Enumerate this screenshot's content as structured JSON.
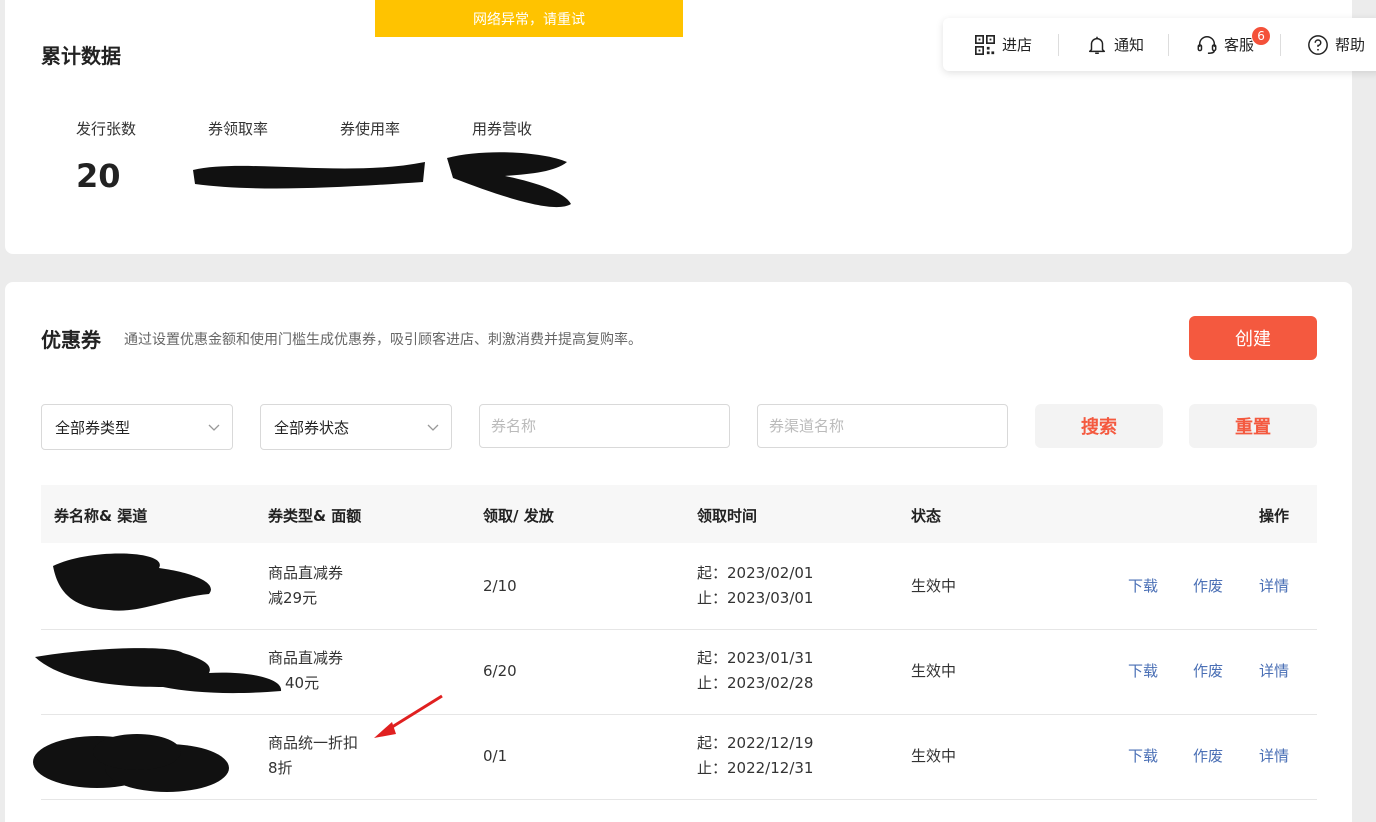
{
  "banner": {
    "text": "网络异常，请重试"
  },
  "topnav": {
    "items": [
      {
        "label": "进店",
        "icon": "qr-code-icon"
      },
      {
        "label": "通知",
        "icon": "bell-icon"
      },
      {
        "label": "客服",
        "icon": "headset-icon",
        "badge": "6"
      },
      {
        "label": "帮助",
        "icon": "help-circle-icon"
      }
    ]
  },
  "summary": {
    "title": "累计数据",
    "stats": [
      {
        "label": "发行张数",
        "value": "20"
      },
      {
        "label": "券领取率",
        "value": ""
      },
      {
        "label": "券使用率",
        "value": ""
      },
      {
        "label": "用券营收",
        "value": ""
      }
    ]
  },
  "coupons": {
    "title": "优惠券",
    "description": "通过设置优惠金额和使用门槛生成优惠券，吸引顾客进店、刺激消费并提高复购率。",
    "create_label": "创建",
    "filters": {
      "type_select": "全部券类型",
      "status_select": "全部券状态",
      "name_placeholder": "券名称",
      "channel_placeholder": "券渠道名称",
      "search_label": "搜索",
      "reset_label": "重置"
    },
    "columns": [
      "券名称& 渠道",
      "券类型& 面额",
      "领取/ 发放",
      "领取时间",
      "状态",
      "操作"
    ],
    "rows": [
      {
        "type": "商品直减券",
        "amount": "减29元",
        "ratio": "2/10",
        "start": "起：2023/02/01",
        "end": "止：2023/03/01",
        "status": "生效中",
        "actions": [
          "下载",
          "作废",
          "详情"
        ]
      },
      {
        "type": "商品直减券",
        "amount": "40元",
        "ratio": "6/20",
        "start": "起：2023/01/31",
        "end": "止：2023/02/28",
        "status": "生效中",
        "actions": [
          "下载",
          "作废",
          "详情"
        ]
      },
      {
        "type": "商品统一折扣",
        "amount": "8折",
        "ratio": "0/1",
        "start": "起：2022/12/19",
        "end": "止：2022/12/31",
        "status": "生效中",
        "actions": [
          "下载",
          "作废",
          "详情"
        ]
      }
    ]
  },
  "colors": {
    "accent": "#f4593f",
    "banner": "#ffc300",
    "link": "#4a6fb5",
    "arrow": "#e02020"
  }
}
